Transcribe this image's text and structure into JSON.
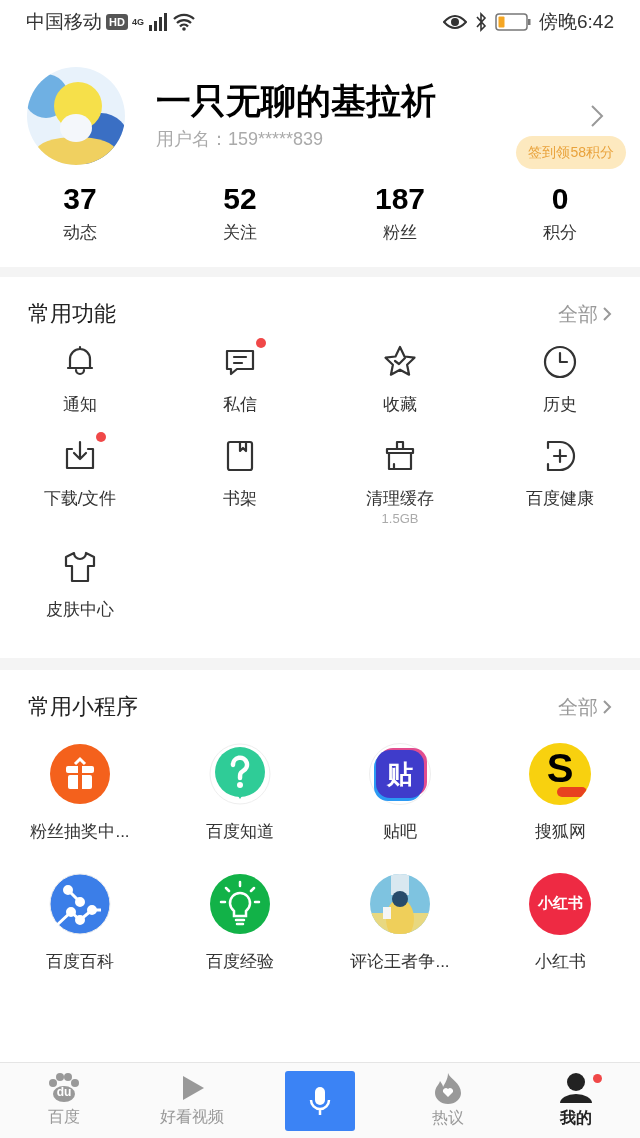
{
  "status_bar": {
    "carrier": "中国移动",
    "hd": "HD",
    "network": "4G",
    "time": "傍晚6:42"
  },
  "profile": {
    "name": "一只无聊的基拉祈",
    "username": "用户名：159*****839",
    "checkin_tip": "签到领58积分"
  },
  "stats": [
    {
      "value": "37",
      "label": "动态"
    },
    {
      "value": "52",
      "label": "关注"
    },
    {
      "value": "187",
      "label": "粉丝"
    },
    {
      "value": "0",
      "label": "积分"
    }
  ],
  "functions": {
    "title": "常用功能",
    "more": "全部",
    "items": [
      {
        "kind": "bell",
        "label": "通知",
        "dot": false
      },
      {
        "kind": "chat",
        "label": "私信",
        "dot": true
      },
      {
        "kind": "star",
        "label": "收藏",
        "dot": false
      },
      {
        "kind": "clock",
        "label": "历史",
        "dot": false
      },
      {
        "kind": "download",
        "label": "下载/文件",
        "dot": true
      },
      {
        "kind": "book",
        "label": "书架",
        "dot": false
      },
      {
        "kind": "brush",
        "label": "清理缓存",
        "sub": "1.5GB",
        "dot": false
      },
      {
        "kind": "health",
        "label": "百度健康",
        "dot": false
      },
      {
        "kind": "shirt",
        "label": "皮肤中心",
        "dot": false
      }
    ]
  },
  "mini_programs": {
    "title": "常用小程序",
    "more": "全部",
    "items": [
      {
        "kind": "gift",
        "label": "粉丝抽奖中..."
      },
      {
        "kind": "question",
        "label": "百度知道"
      },
      {
        "kind": "tieba",
        "label": "贴吧",
        "logo_text": "贴"
      },
      {
        "kind": "sohu",
        "label": "搜狐网",
        "logo_text": "S"
      },
      {
        "kind": "graph",
        "label": "百度百科"
      },
      {
        "kind": "bulb",
        "label": "百度经验"
      },
      {
        "kind": "picture",
        "label": "评论王者争..."
      },
      {
        "kind": "xhs",
        "label": "小红书",
        "logo_text": "小红书"
      }
    ]
  },
  "tab_bar": [
    {
      "kind": "paw",
      "label": "百度",
      "logo_text": "du",
      "selected": false,
      "dot": false
    },
    {
      "kind": "play",
      "label": "好看视频",
      "selected": false,
      "dot": false
    },
    {
      "kind": "mic",
      "selected": false
    },
    {
      "kind": "flame",
      "label": "热议",
      "selected": false,
      "dot": false
    },
    {
      "kind": "person",
      "label": "我的",
      "selected": true,
      "dot": true
    }
  ]
}
